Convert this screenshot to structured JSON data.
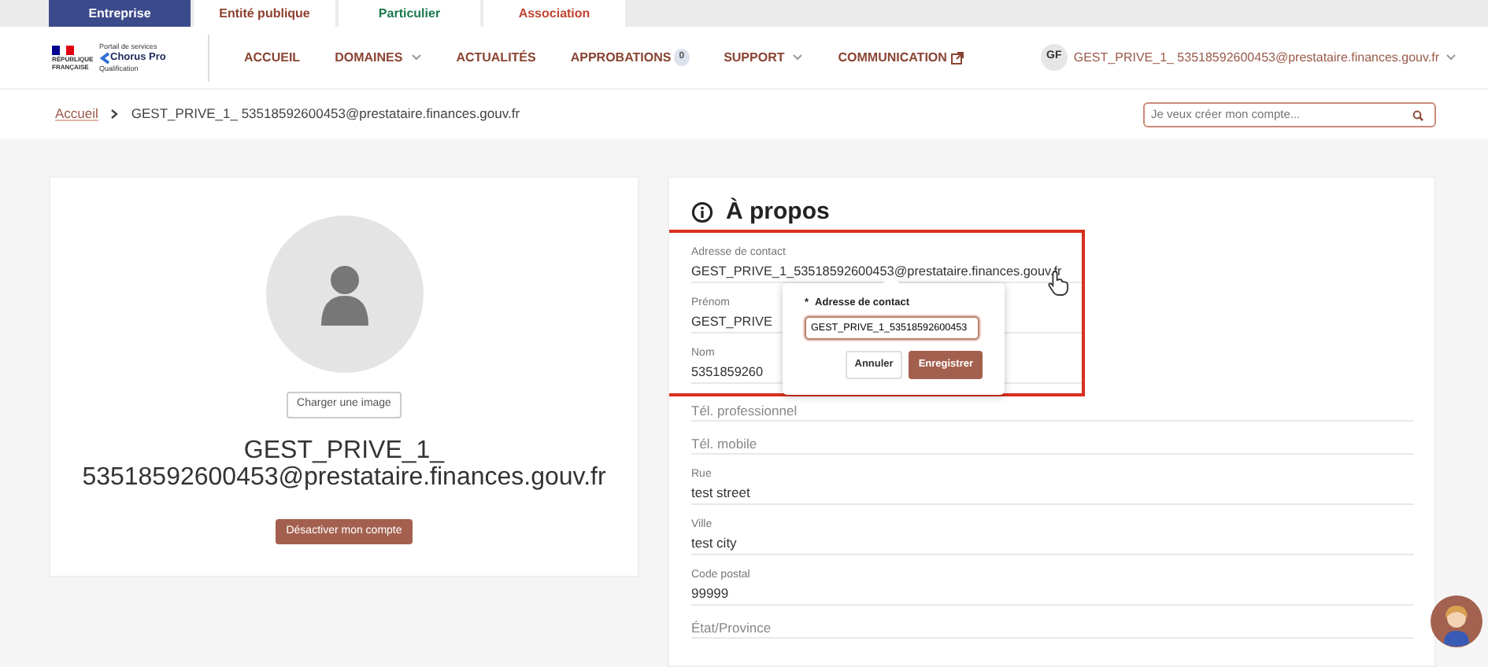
{
  "tabs": [
    {
      "label": "Entreprise",
      "selected": true,
      "color": "#3b4a8b"
    },
    {
      "label": "Entité publique",
      "selected": false,
      "color": "#8c3f2e"
    },
    {
      "label": "Particulier",
      "selected": false,
      "color": "#1c7a4c"
    },
    {
      "label": "Association",
      "selected": false,
      "color": "#c0432e"
    }
  ],
  "logo": {
    "republic": "RÉPUBLIQUE FRANÇAISE",
    "portal": "Portail de services",
    "product": "Chorus Pro",
    "env": "Qualification"
  },
  "nav": [
    {
      "label": "ACCUEIL",
      "kind": "plain"
    },
    {
      "label": "DOMAINES",
      "kind": "dropdown"
    },
    {
      "label": "ACTUALITÉS",
      "kind": "plain"
    },
    {
      "label": "APPROBATIONS",
      "kind": "badge",
      "badge": "0"
    },
    {
      "label": "SUPPORT",
      "kind": "dropdown"
    },
    {
      "label": "COMMUNICATION",
      "kind": "external"
    }
  ],
  "user": {
    "initials": "GF",
    "email": "GEST_PRIVE_1_ 53518592600453@prestataire.finances.gouv.fr"
  },
  "breadcrumb": [
    "Accueil",
    "GEST_PRIVE_1_ 53518592600453@prestataire.finances.gouv.fr"
  ],
  "search": {
    "placeholder": "Je veux créer mon compte..."
  },
  "profile": {
    "upload_button": "Charger une image",
    "name": "GEST_PRIVE_1_ 53518592600453@prestataire.finances.gouv.fr",
    "deactivate_button": "Désactiver mon compte"
  },
  "about": {
    "title": "À propos",
    "highlight_box": true,
    "fields": [
      {
        "label": "Adresse de contact",
        "value": "GEST_PRIVE_1_53518592600453@prestataire.finances.gouv.fr"
      },
      {
        "label": "Prénom",
        "value": "GEST_PRIVE"
      },
      {
        "label": "Nom",
        "value": "5351859260"
      },
      {
        "label": "Tél. professionnel"
      },
      {
        "label": "Tél. mobile"
      },
      {
        "label": "Rue",
        "value": "test street"
      },
      {
        "label": "Ville",
        "value": "test city"
      },
      {
        "label": "Code postal",
        "value": "99999"
      },
      {
        "label": "État/Province"
      }
    ],
    "popover": {
      "required_mark": "*",
      "label": "Adresse de contact",
      "value": "GEST_PRIVE_1_53518592600453",
      "cancel": "Annuler",
      "save": "Enregistrer"
    }
  }
}
